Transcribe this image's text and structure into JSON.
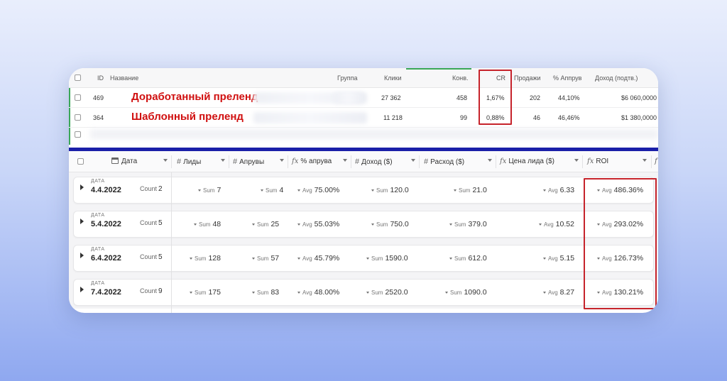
{
  "top_table": {
    "headers": {
      "id": "ID",
      "name": "Название",
      "group": "Группа",
      "clicks": "Клики",
      "conv": "Конв.",
      "cr": "CR",
      "sales": "Продажи",
      "approve_pct": "% Аппрув",
      "income": "Доход (подтв.)"
    },
    "rows": [
      {
        "id": "469",
        "name": "Доработанный преленд",
        "clicks": "27 362",
        "conv": "458",
        "cr": "1,67%",
        "sales": "202",
        "approve_pct": "44,10%",
        "income": "$6 060,0000"
      },
      {
        "id": "364",
        "name": "Шаблонный преленд",
        "clicks": "11 218",
        "conv": "99",
        "cr": "0,88%",
        "sales": "46",
        "approve_pct": "46,46%",
        "income": "$1 380,0000"
      }
    ]
  },
  "grid": {
    "headers": {
      "date": "Дата",
      "leads": "Лиды",
      "approves": "Апрувы",
      "approve_pct": "% апрува",
      "income": "Доход ($)",
      "expense": "Расход ($)",
      "lead_price": "Цена лида ($)",
      "roi": "ROI"
    },
    "date_label": "ДАТА",
    "count_label": "Count",
    "sum_label": "Sum",
    "avg_label": "Avg",
    "rows": [
      {
        "date": "4.4.2022",
        "count": "2",
        "leads": "7",
        "approves": "4",
        "approve_pct": "75.00%",
        "income": "120.0",
        "expense": "21.0",
        "lead_price": "6.33",
        "roi": "486.36%"
      },
      {
        "date": "5.4.2022",
        "count": "5",
        "leads": "48",
        "approves": "25",
        "approve_pct": "55.03%",
        "income": "750.0",
        "expense": "379.0",
        "lead_price": "10.52",
        "roi": "293.02%"
      },
      {
        "date": "6.4.2022",
        "count": "5",
        "leads": "128",
        "approves": "57",
        "approve_pct": "45.79%",
        "income": "1590.0",
        "expense": "612.0",
        "lead_price": "5.15",
        "roi": "126.73%"
      },
      {
        "date": "7.4.2022",
        "count": "9",
        "leads": "175",
        "approves": "83",
        "approve_pct": "48.00%",
        "income": "2520.0",
        "expense": "1090.0",
        "lead_price": "8.27",
        "roi": "130.21%"
      }
    ]
  },
  "colors": {
    "highlight_red": "#c6232b",
    "name_red": "#d01010",
    "divider_blue": "#1a1fa8",
    "green_accent": "#3aa757"
  }
}
